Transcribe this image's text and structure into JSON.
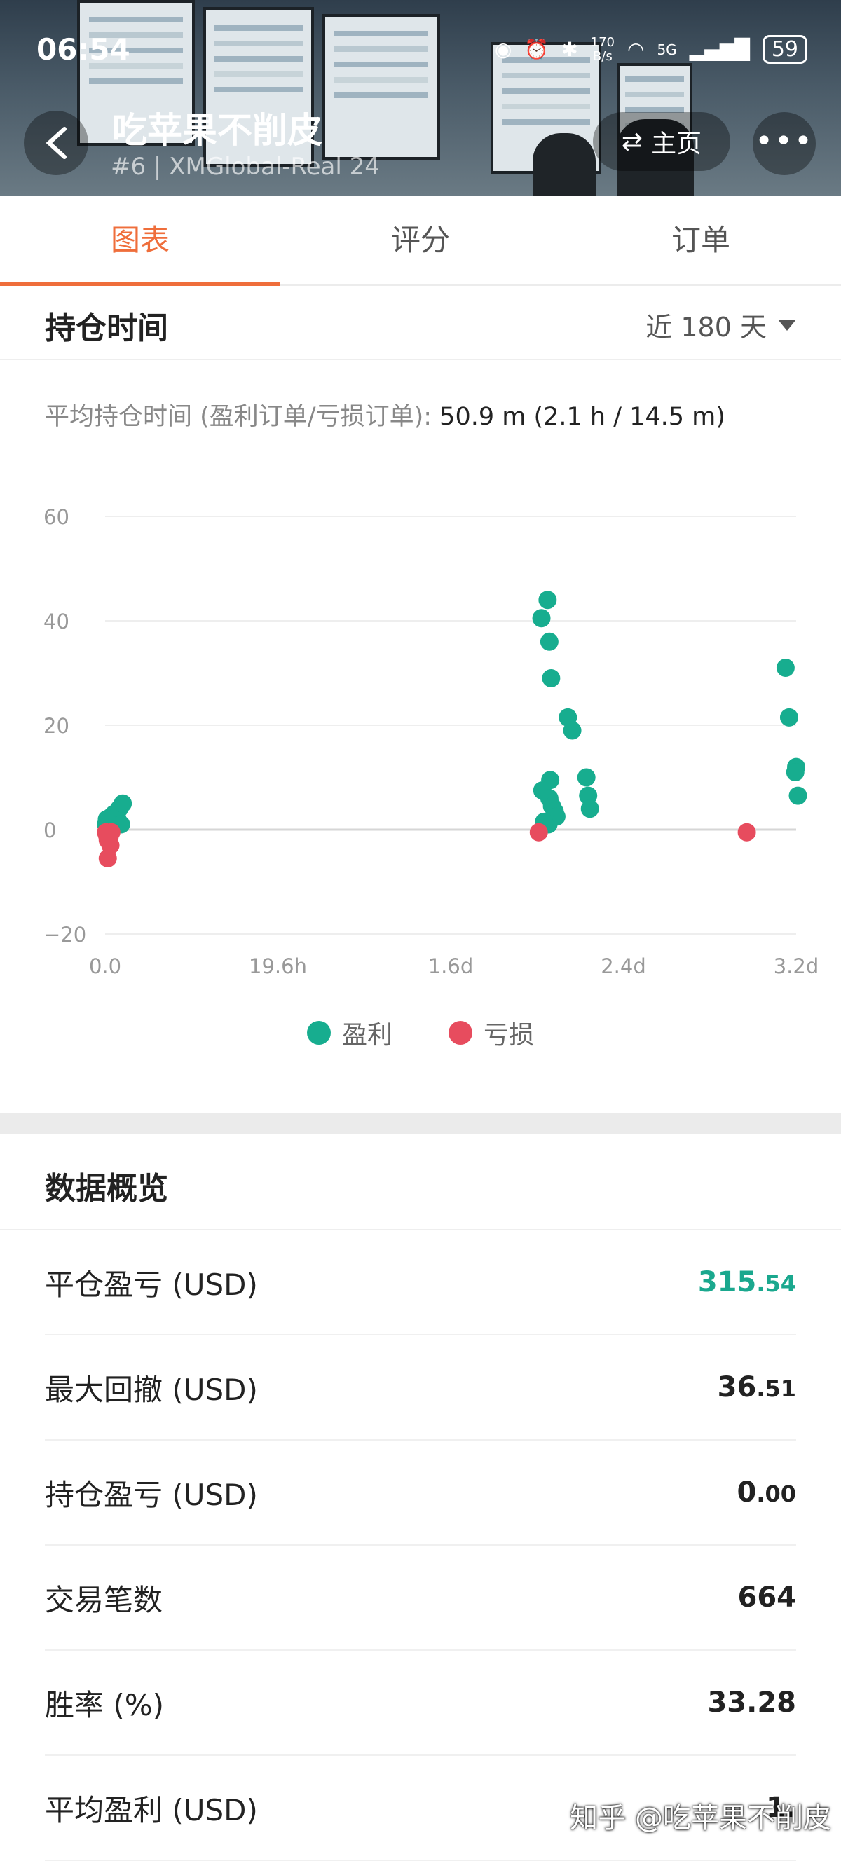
{
  "status": {
    "time": "06:54",
    "net_speed_top": "170",
    "net_speed_unit": "B/s",
    "network": "5G",
    "battery": "59"
  },
  "header": {
    "title": "吃苹果不削皮",
    "subtitle": "#6 | XMGlobal-Real 24",
    "home_label": "主页",
    "more_label": "•••"
  },
  "tabs": [
    {
      "label": "图表",
      "active": true
    },
    {
      "label": "评分",
      "active": false
    },
    {
      "label": "订单",
      "active": false
    }
  ],
  "holding": {
    "title": "持仓时间",
    "range": "近 180 天",
    "avg_label": "平均持仓时间 (盈利订单/亏损订单):",
    "avg_value": "50.9 m (2.1 h / 14.5 m)"
  },
  "chart_data": {
    "type": "scatter",
    "xlabel": "",
    "ylabel": "",
    "x_ticks": [
      "0.0",
      "19.6h",
      "1.6d",
      "2.4d",
      "3.2d"
    ],
    "x_tick_hours": [
      0,
      19.6,
      39.2,
      58.8,
      78.4
    ],
    "xlim_hours": [
      0,
      78.4
    ],
    "y_ticks": [
      "60",
      "40",
      "20",
      "0",
      "−20"
    ],
    "ylim": [
      -20,
      60
    ],
    "grid": true,
    "legend_position": "bottom",
    "series": [
      {
        "name": "盈利",
        "color": "#17ad8f",
        "points": [
          [
            0.1,
            1
          ],
          [
            0.2,
            2
          ],
          [
            0.4,
            0.5
          ],
          [
            0.5,
            1.5
          ],
          [
            0.7,
            2.5
          ],
          [
            0.9,
            1
          ],
          [
            1.0,
            3
          ],
          [
            1.2,
            0.8
          ],
          [
            1.4,
            2
          ],
          [
            1.6,
            4
          ],
          [
            1.8,
            1
          ],
          [
            2.0,
            5
          ],
          [
            49.5,
            40.5
          ],
          [
            50.2,
            44
          ],
          [
            50.4,
            36
          ],
          [
            50.6,
            29
          ],
          [
            52.5,
            21.5
          ],
          [
            53.0,
            19
          ],
          [
            50.5,
            9.5
          ],
          [
            49.6,
            7.5
          ],
          [
            50.4,
            6
          ],
          [
            50.7,
            4.5
          ],
          [
            51.0,
            3.5
          ],
          [
            51.2,
            2.5
          ],
          [
            50.3,
            1
          ],
          [
            49.8,
            1.5
          ],
          [
            54.6,
            10
          ],
          [
            54.8,
            6.5
          ],
          [
            55.0,
            4
          ],
          [
            77.2,
            31
          ],
          [
            77.6,
            21.5
          ],
          [
            78.4,
            12
          ],
          [
            78.3,
            11
          ],
          [
            78.6,
            6.5
          ]
        ]
      },
      {
        "name": "亏损",
        "color": "#e74c5e",
        "points": [
          [
            0.1,
            -0.5
          ],
          [
            0.2,
            -1
          ],
          [
            0.3,
            -2
          ],
          [
            0.4,
            -0.8
          ],
          [
            0.5,
            -1.5
          ],
          [
            0.6,
            -3
          ],
          [
            0.7,
            -0.5
          ],
          [
            0.3,
            -5.5
          ],
          [
            49.2,
            -0.5
          ],
          [
            72.8,
            -0.5
          ]
        ]
      }
    ]
  },
  "overview": {
    "title": "数据概览",
    "rows": [
      {
        "label": "平仓盈亏 (USD)",
        "int": "315",
        "dec": ".54",
        "color": "#1aa88e"
      },
      {
        "label": "最大回撤 (USD)",
        "int": "36",
        "dec": ".51",
        "color": "#222222"
      },
      {
        "label": "持仓盈亏 (USD)",
        "int": "0",
        "dec": ".00",
        "color": "#222222"
      },
      {
        "label": "交易笔数",
        "int": "664",
        "dec": "",
        "color": "#222222"
      },
      {
        "label": "胜率 (%)",
        "int": "33.28",
        "dec": "",
        "color": "#222222"
      },
      {
        "label": "平均盈利 (USD)",
        "int": "1.",
        "dec": "",
        "color": "#222222"
      }
    ]
  },
  "watermark": "知乎 @吃苹果不削皮"
}
